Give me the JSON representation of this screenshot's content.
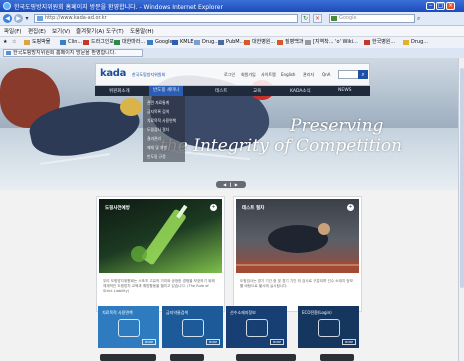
{
  "window": {
    "title": "한국도핑방지위원회 홈페이지 방문을 환영합니다. - Windows Internet Explorer"
  },
  "address_bar": {
    "url": "http://www.kada-ad.or.kr",
    "search_placeholder": "Google"
  },
  "menu_bar": {
    "items": [
      "파일(F)",
      "편집(E)",
      "보기(V)",
      "즐겨찾기(A)",
      "도구(T)",
      "도움말(H)"
    ]
  },
  "favorites_bar": {
    "items": [
      "도핑박물",
      "Clin...",
      "드라그인포",
      "대한마라...",
      "Google",
      "KMLE",
      "Drug...",
      "PubM...",
      "대한병원...",
      "질병백과",
      "[지역착... 'o' Wiki...",
      "한국병원...",
      "Drug..."
    ]
  },
  "tab": {
    "label": "한국도핑방지위원회 홈페이지 방문을 환영합니다."
  },
  "site": {
    "logo_text": "kada",
    "logo_sub": "한국도핑방지위원회",
    "utility_links": [
      "로그인",
      "회원가입",
      "사이트맵",
      "English",
      "관리자",
      "QnA"
    ],
    "gnb": [
      "위원회소개",
      "반도핑 세미나",
      "테스트",
      "교육",
      "KADA소식",
      "NEWS"
    ],
    "gnb_active_index": 1,
    "submenu": [
      "관련 자료통계",
      "금지목록 검색",
      "치료목적 사용면책",
      "도핑검사 절차",
      "결과관리",
      "제재 및 처벌",
      "반도핑 규정"
    ],
    "hero_line1": "Preserving",
    "hero_line2": "the Integrity of Competition",
    "slider_control": "◀ ‖ ▶",
    "cards": [
      {
        "title": "도핑사전예방",
        "desc": "우리 도핑방지위원회는 스포츠 고유의 가치와 공정한 경쟁을 보호하기 위해 체계적인 도핑방지 교육과 예방활동을 펼치고 있습니다. (The Rule of Strict Liability)"
      },
      {
        "title": "테스트 절차",
        "desc": "도핑검사는 경기 기간 중 및 경기 기간 외 검사로 구분되며 선수 소재지 정보를 바탕으로 불시에 실시됩니다."
      }
    ],
    "tiles": [
      {
        "label": "치료목적 사용면책",
        "btn": "MORE",
        "color": "#2e7bc0"
      },
      {
        "label": "금지약물검색",
        "btn": "MORE",
        "color": "#1d5a9a"
      },
      {
        "label": "선수소재지정보",
        "btn": "MORE",
        "color": "#173f73"
      },
      {
        "label": "ECO전환(Login)",
        "btn": "MORE",
        "color": "#14365f"
      }
    ]
  }
}
